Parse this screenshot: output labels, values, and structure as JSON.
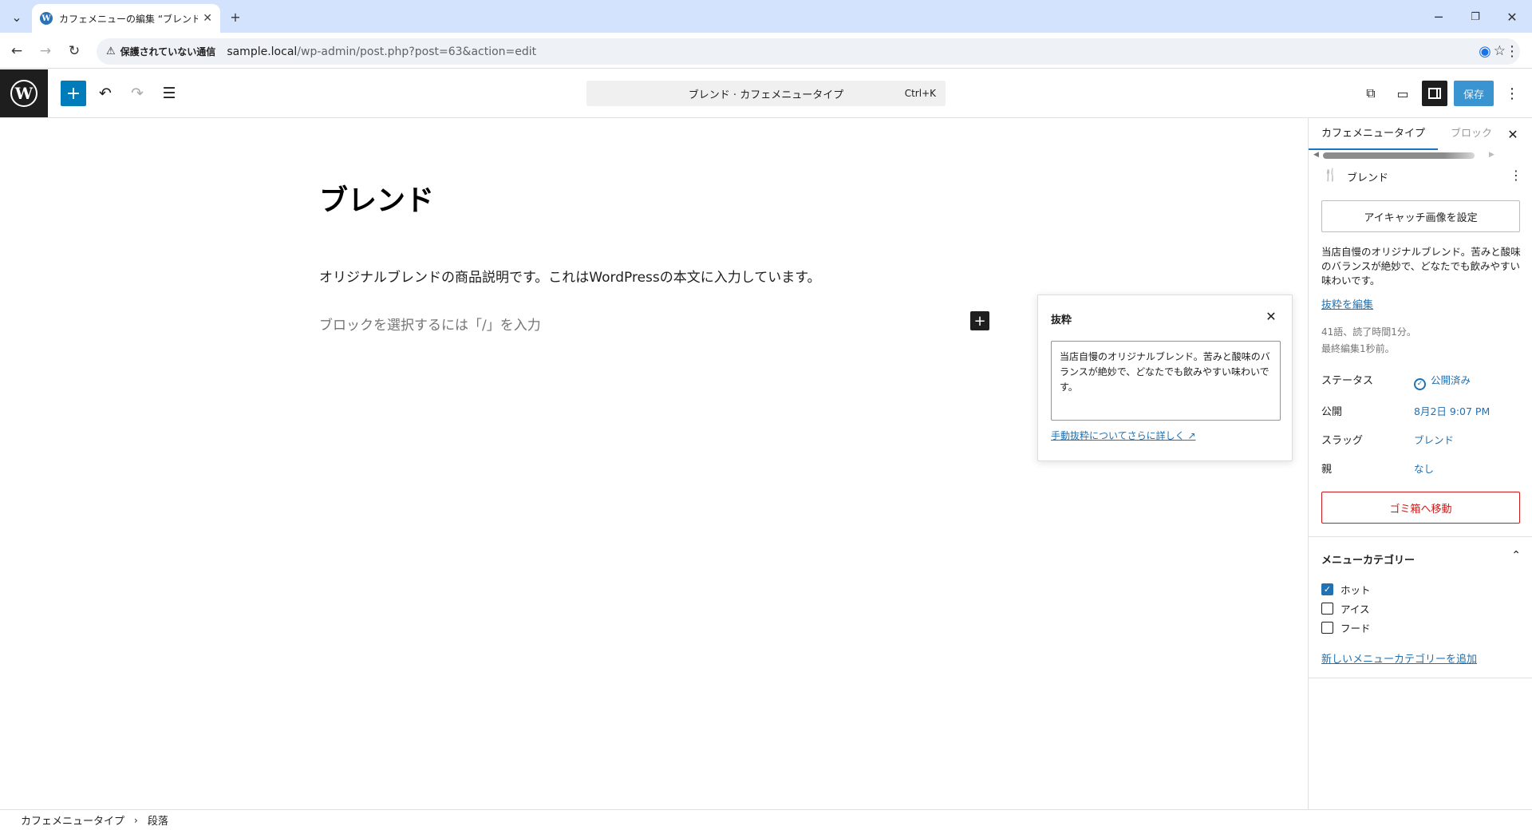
{
  "browser": {
    "tab_title": "カフェメニューの編集 “ブレンド” ‹ サン",
    "url_security": "保護されていない通信",
    "url_host": "sample.local",
    "url_path": "/wp-admin/post.php?post=63&action=edit"
  },
  "header": {
    "command_title": "ブレンド · カフェメニュータイプ",
    "command_shortcut": "Ctrl+K",
    "save_label": "保存"
  },
  "editor": {
    "title": "ブレンド",
    "paragraph": "オリジナルブレンドの商品説明です。これはWordPressの本文に入力しています。",
    "placeholder": "ブロックを選択するには「/」を入力"
  },
  "excerpt_popover": {
    "heading": "抜粋",
    "text": "当店自慢のオリジナルブレンド。苦みと酸味のバランスが絶妙で、どなたでも飲みやすい味わいです。",
    "learn_more": "手動抜粋についてさらに詳しく ↗"
  },
  "sidebar": {
    "tab_post": "カフェメニュータイプ",
    "tab_block": "ブロック",
    "post_title": "ブレンド",
    "featured_image": "アイキャッチ画像を設定",
    "excerpt_preview": "当店自慢のオリジナルブレンド。苦みと酸味のバランスが絶妙で、どなたでも飲みやすい味わいです。",
    "edit_excerpt": "抜粋を編集",
    "stats_words": "41語、読了時間1分。",
    "stats_edited": "最終編集1秒前。",
    "rows": [
      {
        "label": "ステータス",
        "value": "公開済み"
      },
      {
        "label": "公開",
        "value": "8月2日 9:07 PM"
      },
      {
        "label": "スラッグ",
        "value": "ブレンド"
      },
      {
        "label": "親",
        "value": "なし"
      }
    ],
    "trash": "ゴミ箱へ移動",
    "category_title": "メニューカテゴリー",
    "categories": [
      {
        "label": "ホット",
        "checked": true
      },
      {
        "label": "アイス",
        "checked": false
      },
      {
        "label": "フード",
        "checked": false
      }
    ],
    "add_category": "新しいメニューカテゴリーを追加"
  },
  "footer": {
    "crumb1": "カフェメニュータイプ",
    "crumb2": "段落"
  },
  "colors": {
    "accent": "#007cba",
    "link": "#2271b1",
    "danger": "#cc1818"
  }
}
